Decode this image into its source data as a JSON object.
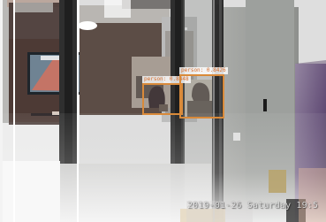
{
  "detections": [
    {
      "label": "person: 0.8448"
    },
    {
      "label": "person: 0.8426"
    }
  ],
  "timestamp": "2019-01-26 Saturday 19:5"
}
